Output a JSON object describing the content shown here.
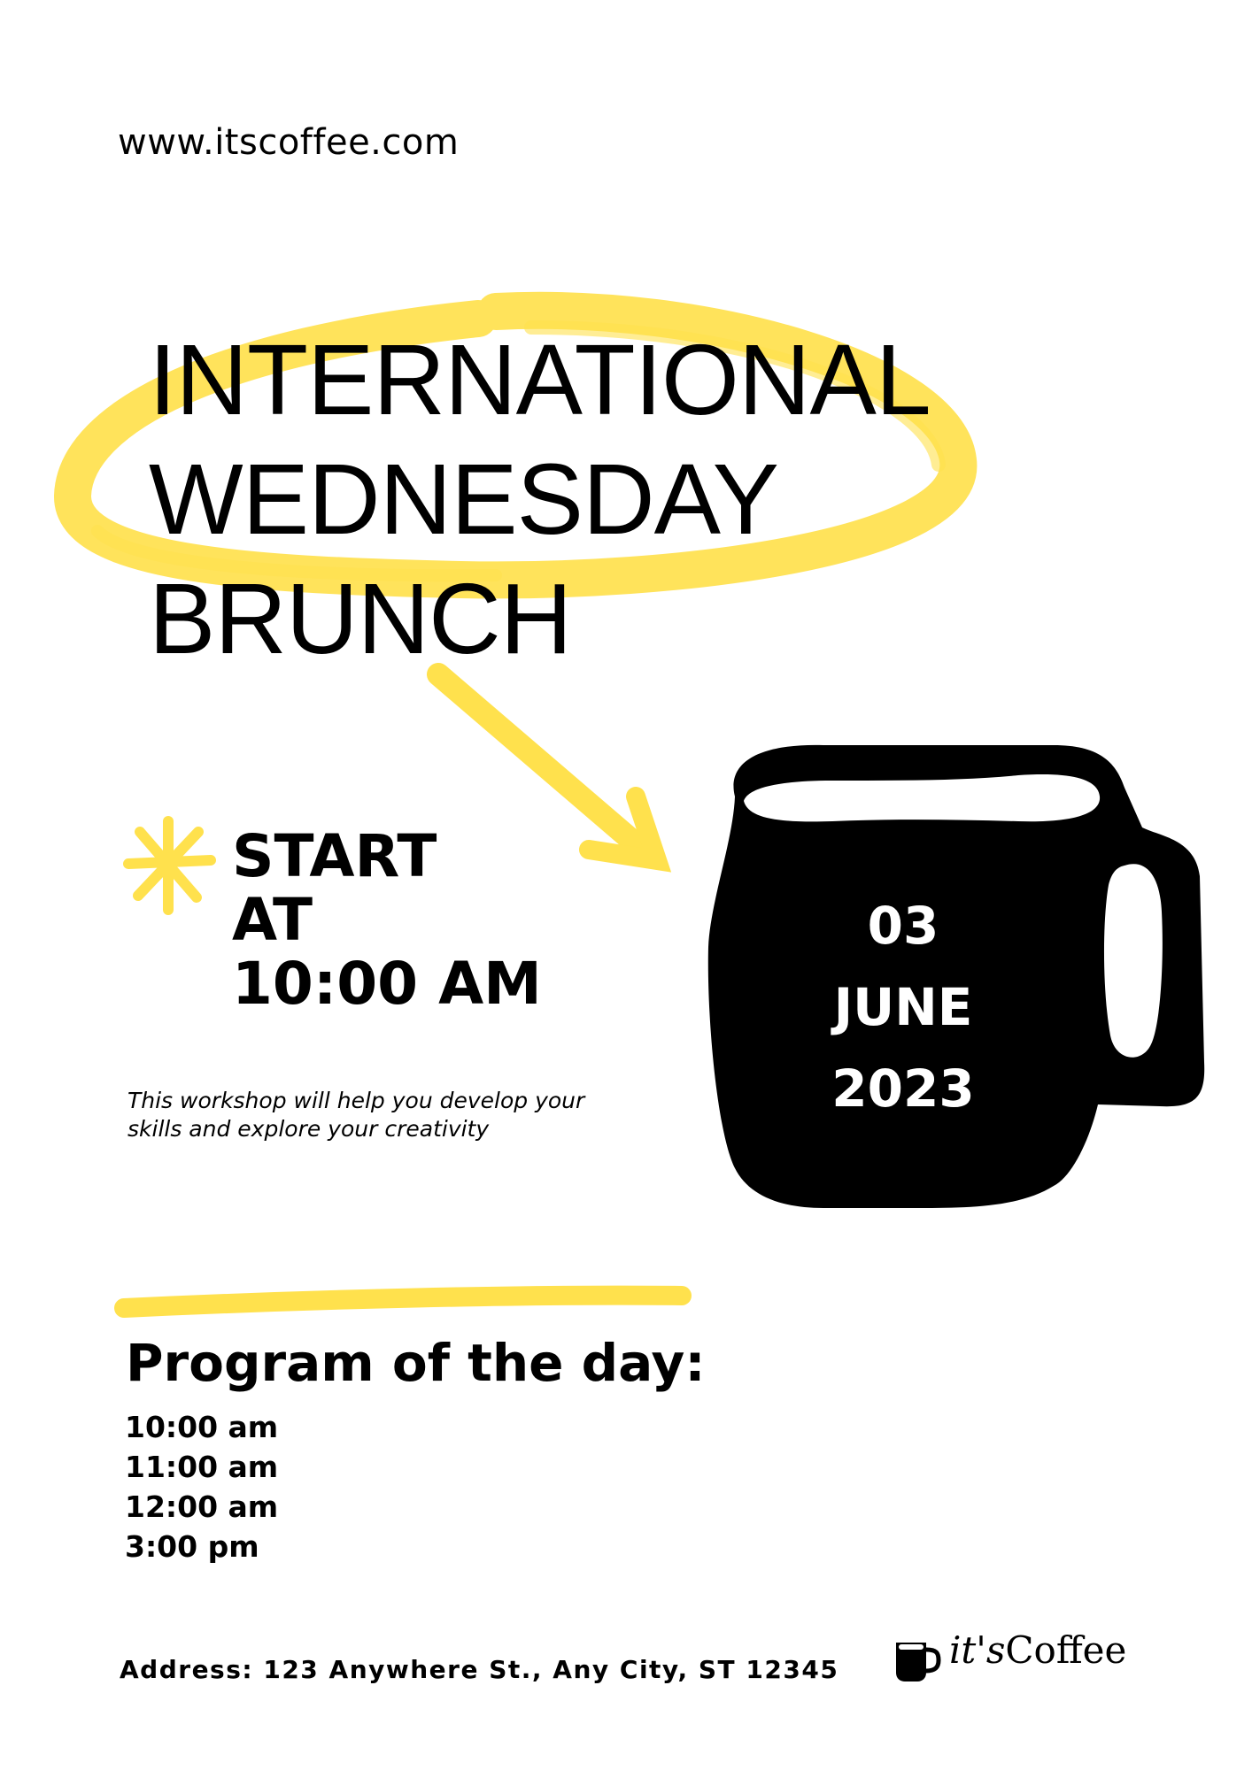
{
  "website": "www.itscoffee.com",
  "title_lines": [
    "INTERNATIONAL",
    "WEDNESDAY",
    "BRUNCH"
  ],
  "start_lines": [
    "START",
    "AT",
    "10:00 AM"
  ],
  "date_lines": [
    "03",
    "JUNE",
    "2023"
  ],
  "description": "This workshop will help you develop your skills and explore your creativity",
  "program": {
    "title": "Program of the day:",
    "times": [
      "10:00 am",
      "11:00 am",
      "12:00 am",
      "3:00 pm"
    ]
  },
  "address": "Address: 123 Anywhere St., Any City, ST 12345",
  "logo": {
    "its": "it's",
    "coffee": "Coffee"
  },
  "colors": {
    "accent_yellow": "#FFE14D",
    "ink": "#000000",
    "background": "#FFFFFF"
  }
}
